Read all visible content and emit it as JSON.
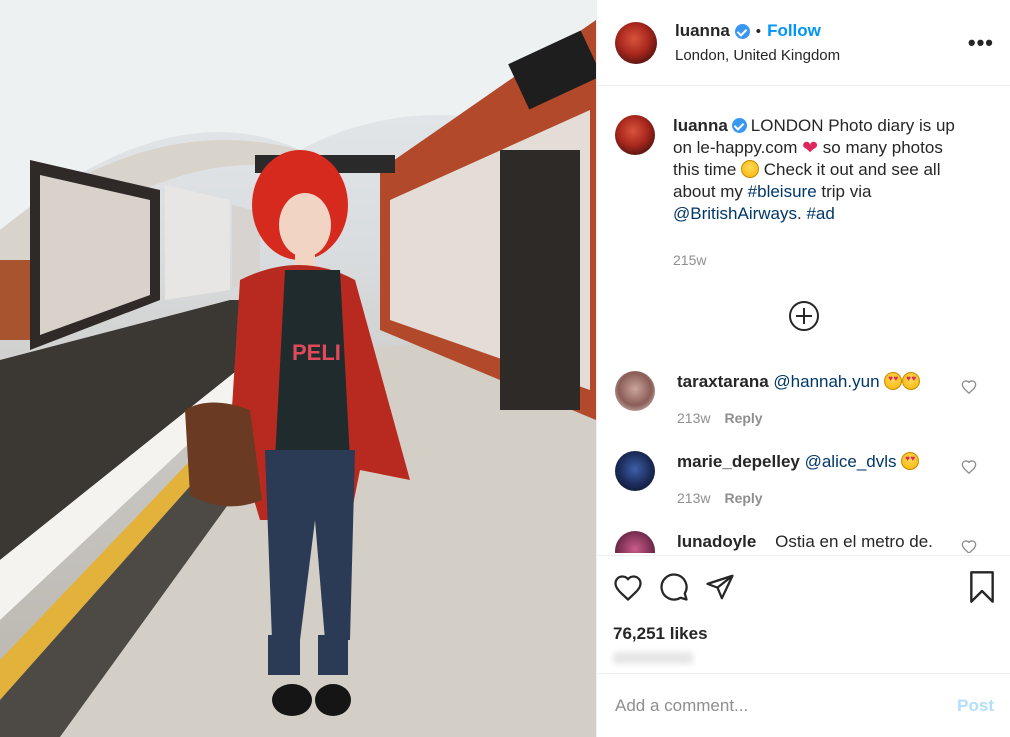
{
  "header": {
    "username": "luanna",
    "dot": "•",
    "follow_label": "Follow",
    "location": "London, United Kingdom",
    "more_label": "•••"
  },
  "caption": {
    "username": "luanna",
    "text_1": "LONDON Photo diary is up on le-happy.com",
    "text_2": " so many photos this time",
    "text_3": " Check it out and see all about my ",
    "hashtag_1": "#bleisure",
    "text_4": " trip via ",
    "mention": "@BritishAirways",
    "text_5": ". ",
    "hashtag_2": "#ad",
    "time": "215w"
  },
  "comments": [
    {
      "username": "taraxtarana",
      "text": "@hannah.yun",
      "time": "213w",
      "reply_label": "Reply"
    },
    {
      "username": "marie_depelley",
      "text": "@alice_dvls",
      "time": "213w",
      "reply_label": "Reply"
    },
    {
      "username": "lunadoyle",
      "text": "Ostia en el metro de."
    }
  ],
  "likes": "76,251 likes",
  "add_comment": {
    "placeholder": "Add a comment...",
    "post_label": "Post"
  },
  "colors": {
    "accent": "#0095f6",
    "verified": "#3897f0",
    "post_disabled": "#b2dffc"
  }
}
